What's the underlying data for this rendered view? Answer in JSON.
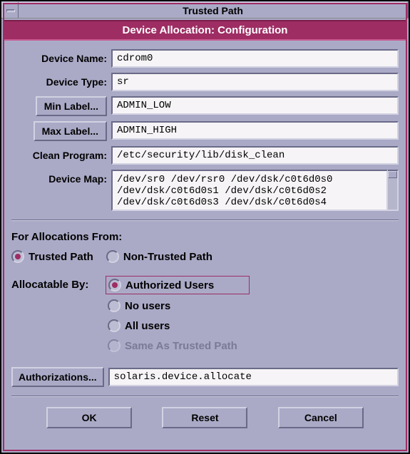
{
  "window": {
    "title": "Trusted Path",
    "subtitle": "Device Allocation: Configuration"
  },
  "form": {
    "device_name_label": "Device Name:",
    "device_name": "cdrom0",
    "device_type_label": "Device Type:",
    "device_type": "sr",
    "min_label_btn": "Min Label...",
    "min_label": "ADMIN_LOW",
    "max_label_btn": "Max Label...",
    "max_label": "ADMIN_HIGH",
    "clean_program_label": "Clean Program:",
    "clean_program": "/etc/security/lib/disk_clean",
    "device_map_label": "Device Map:",
    "device_map": "/dev/sr0 /dev/rsr0 /dev/dsk/c0t6d0s0 /dev/dsk/c0t6d0s1 /dev/dsk/c0t6d0s2 /dev/dsk/c0t6d0s3 /dev/dsk/c0t6d0s4"
  },
  "allocations_from": {
    "label": "For Allocations From:",
    "options": {
      "trusted": "Trusted Path",
      "non_trusted": "Non-Trusted Path"
    },
    "selected": "trusted"
  },
  "allocatable_by": {
    "label": "Allocatable By:",
    "options": {
      "authorized": "Authorized Users",
      "no_users": "No users",
      "all_users": "All users",
      "same_as": "Same As Trusted Path"
    },
    "selected": "authorized",
    "disabled": [
      "same_as"
    ]
  },
  "authorizations": {
    "button": "Authorizations...",
    "value": "solaris.device.allocate"
  },
  "buttons": {
    "ok": "OK",
    "reset": "Reset",
    "cancel": "Cancel"
  }
}
